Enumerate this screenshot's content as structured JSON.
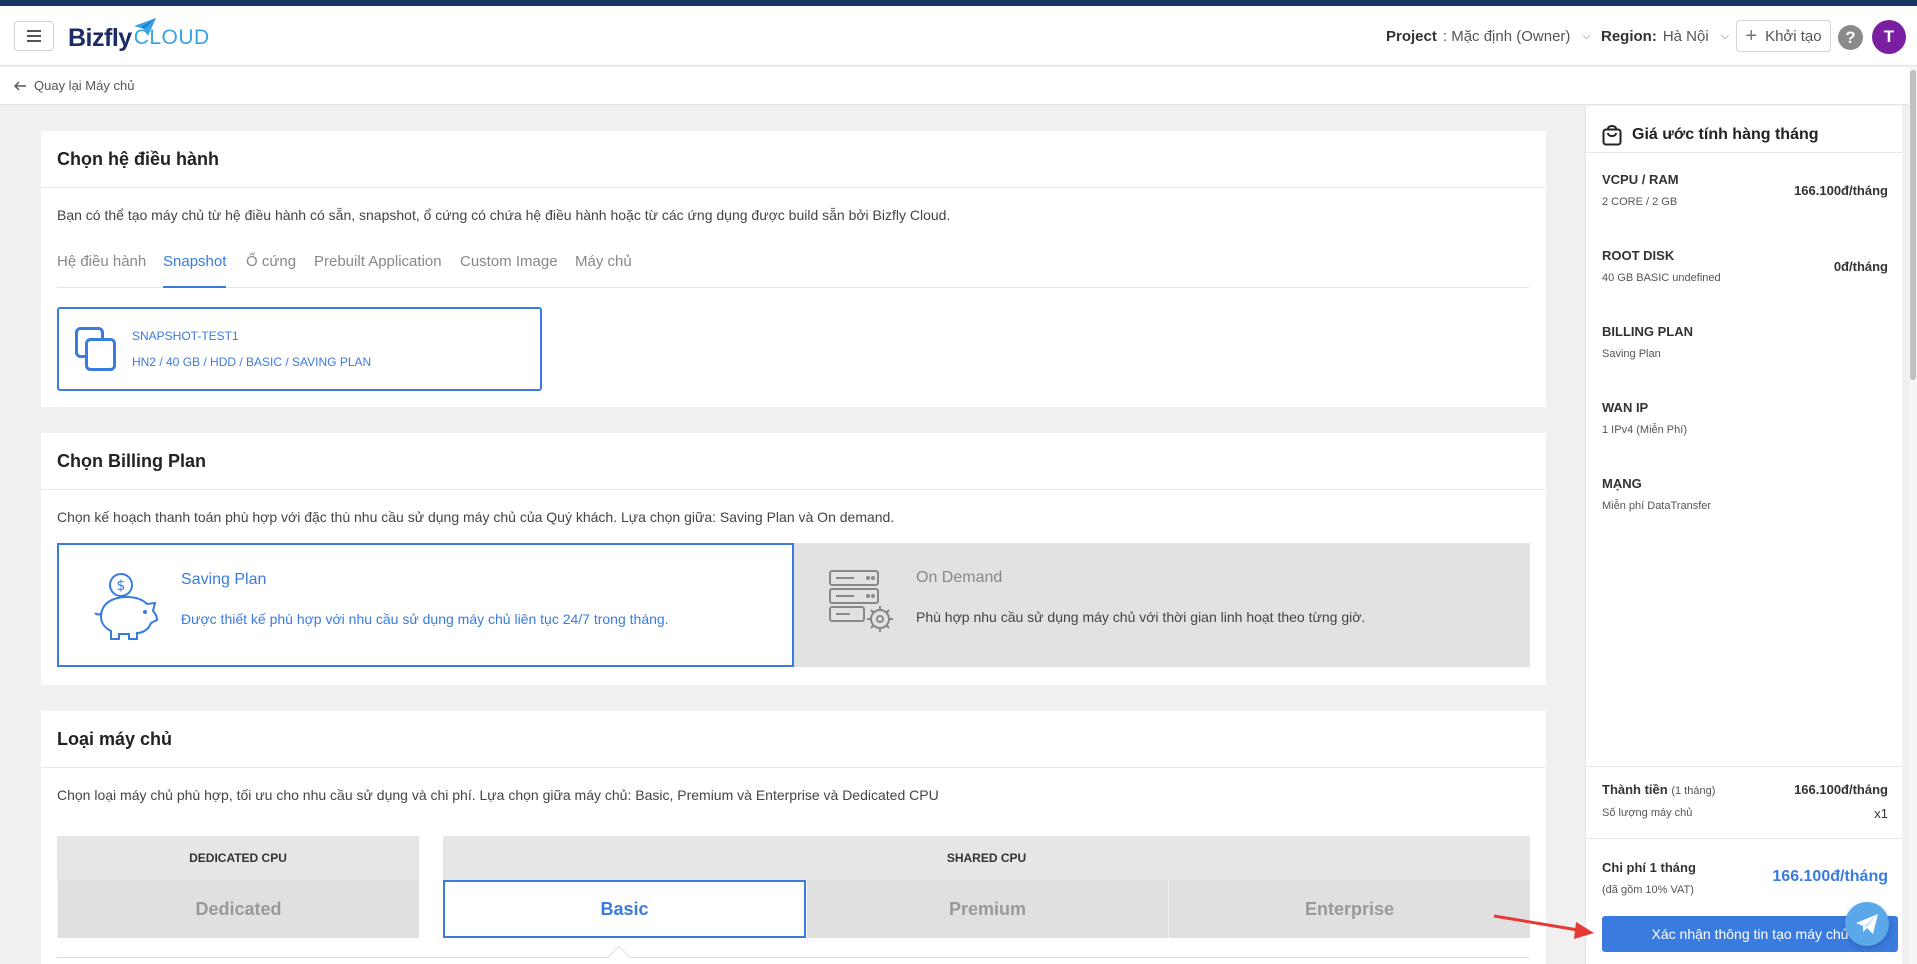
{
  "header": {
    "brand_main": "Bizfly",
    "brand_sub": "CLOUD",
    "project_label": "Project",
    "project_value": ": Mặc định (Owner)",
    "region_label": "Region:",
    "region_value": "Hà Nội",
    "create_label": "Khởi tạo",
    "help_label": "?",
    "avatar_letter": "T"
  },
  "breadcrumb": {
    "back_label": "Quay lại Máy chủ"
  },
  "os_section": {
    "title": "Chọn hệ điều hành",
    "description": "Bạn có thể tạo máy chủ từ hệ điều hành có sẵn, snapshot, ổ cứng có chứa hệ điều hành hoặc từ các ứng dụng được build sẵn bởi Bizfly Cloud.",
    "tabs": [
      "Hệ điều hành",
      "Snapshot",
      "Ổ cứng",
      "Prebuilt Application",
      "Custom Image",
      "Máy chủ"
    ],
    "active_tab": "Snapshot",
    "snapshot": {
      "name": "SNAPSHOT-TEST1",
      "spec": "HN2 / 40 GB / HDD / BASIC / SAVING PLAN"
    }
  },
  "billing_section": {
    "title": "Chọn Billing Plan",
    "description": "Chọn kế hoạch thanh toán phù hợp với đặc thù nhu cầu sử dụng máy chủ của Quý khách. Lựa chọn giữa: Saving Plan và On demand.",
    "plans": [
      {
        "name": "Saving Plan",
        "desc": "Được thiết kế phù hợp với nhu cầu sử dụng máy chủ liên tục 24/7 trong tháng.",
        "selected": true
      },
      {
        "name": "On Demand",
        "desc": "Phù hợp nhu cầu sử dụng máy chủ với thời gian linh hoạt theo từng giờ.",
        "selected": false
      }
    ]
  },
  "server_type_section": {
    "title": "Loại máy chủ",
    "description": "Chọn loại máy chủ phù hợp, tối ưu cho nhu cầu sử dụng và chi phí. Lựa chọn giữa máy chủ: Basic, Premium và Enterprise và Dedicated CPU",
    "dedicated_header": "DEDICATED CPU",
    "shared_header": "SHARED CPU",
    "options": [
      "Dedicated",
      "Basic",
      "Premium",
      "Enterprise"
    ],
    "selected_option": "Basic"
  },
  "estimate": {
    "title": "Giá ước tính hàng tháng",
    "lines": [
      {
        "label": "VCPU / RAM",
        "sub": "2 CORE / 2 GB",
        "price": "166.100đ/tháng"
      },
      {
        "label": "ROOT DISK",
        "sub": "40 GB BASIC undefined",
        "price": "0đ/tháng"
      },
      {
        "label": "BILLING PLAN",
        "sub": "Saving Plan",
        "price": ""
      },
      {
        "label": "WAN IP",
        "sub": "1 IPv4 (Miễn Phí)",
        "price": ""
      },
      {
        "label": "MẠNG",
        "sub": "Miễn phí DataTransfer",
        "price": ""
      }
    ],
    "subtotal_label": "Thành tiền",
    "subtotal_period": "(1 tháng)",
    "subtotal_price": "166.100đ/tháng",
    "quantity_label": "Số lượng máy chủ",
    "quantity_value": "x1",
    "grand_label": "Chi phí 1 tháng",
    "grand_note": "(đã gồm 10% VAT)",
    "grand_price": "166.100đ/tháng",
    "confirm_label": "Xác nhận thông tin tạo máy chủ"
  },
  "colors": {
    "accent": "#3a7be0",
    "brand_dark": "#1d2a64",
    "brand_light": "#36a3e8",
    "avatar": "#7b1fa2",
    "annotation_arrow": "#e53935"
  }
}
